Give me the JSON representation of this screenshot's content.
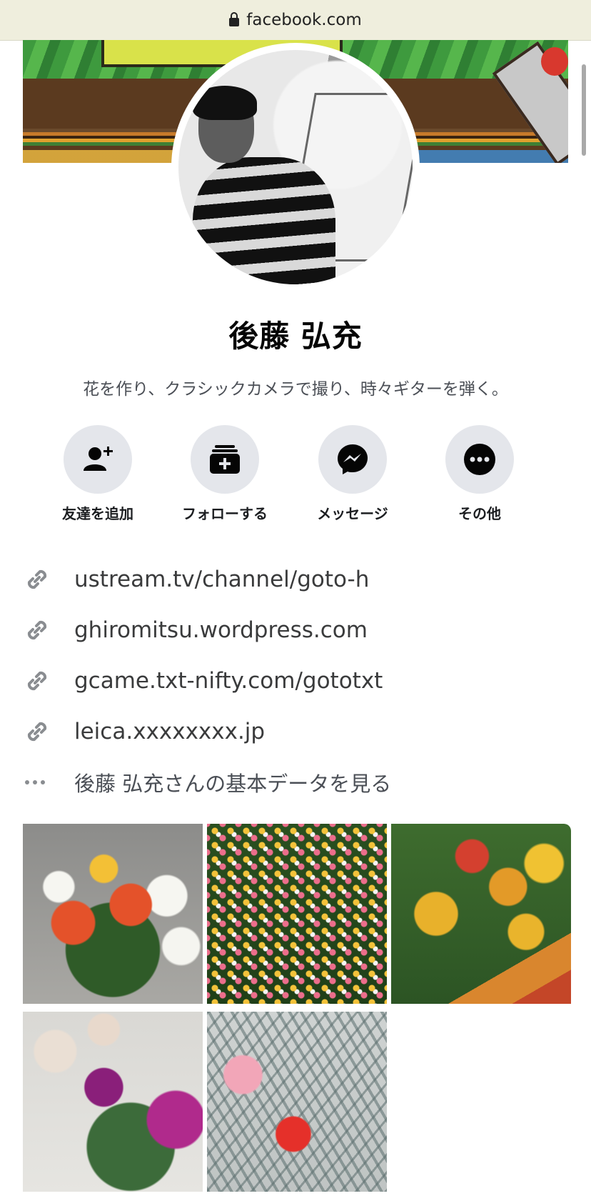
{
  "browser": {
    "url": "facebook.com"
  },
  "profile": {
    "name": "後藤 弘充",
    "bio": "花を作り、クラシックカメラで撮り、時々ギターを弾く。"
  },
  "actions": [
    {
      "label": "友達を追加",
      "icon": "add-friend-icon"
    },
    {
      "label": "フォローする",
      "icon": "follow-icon"
    },
    {
      "label": "メッセージ",
      "icon": "messenger-icon"
    },
    {
      "label": "その他",
      "icon": "more-icon"
    }
  ],
  "links": [
    "ustream.tv/channel/goto-h",
    "ghiromitsu.wordpress.com",
    "gcame.txt-nifty.com/gototxt",
    "leica.xxxxxxxx.jp"
  ],
  "about_link": "後藤 弘充さんの基本データを見る",
  "colors": {
    "accent": "#050505",
    "button_bg": "#e4e6eb",
    "text_secondary": "#4b4f56"
  }
}
